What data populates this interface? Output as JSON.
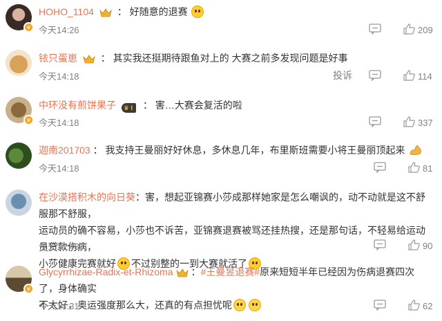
{
  "comments": [
    {
      "user": "HOHO_1104",
      "text": "好随意的退赛",
      "time": "今天14:26",
      "likes": "209"
    },
    {
      "user": "铱只蛋崽",
      "text": "其实我还挺期待跟鱼对上的 大赛之前多发现问题是好事",
      "time": "今天14:18",
      "likes": "114",
      "report_label": "投诉"
    },
    {
      "user": "中环没有煎饼果子",
      "rank": "I",
      "text": "害…大赛会复活的啦",
      "time": "今天14:18",
      "likes": "337"
    },
    {
      "user": "迦南201703",
      "text": "我支持王曼丽好好休息，多休息几年，布里斯班需要小将王曼丽顶起来",
      "time": "今天14:18",
      "likes": "81"
    },
    {
      "user": "在沙漠搭积木的向日葵",
      "text_line1": "害，想起亚锦赛小莎成那样她家是怎么嘲讽的，动不动就是这不舒服那不舒服，",
      "text_line2": "运动员的确不容易，小莎也不诉苦，亚锦赛退赛被骂还挂热搜，还是那句话，不轻易给运动员贷款伤病，",
      "text_line3a": "小莎健康完赛就好",
      "text_line3b": "不过别整的一到大赛就活了",
      "time": "今天14:46",
      "likes": "90"
    },
    {
      "user": "Glycyrrhizae-Radix-et-Rhizoma",
      "hashtag": "#王曼昱退赛#",
      "text_line1": "原来短短半年已经因为伤病退赛四次了，身体确实",
      "text_line2": "不太好，奥运强度那么大，还真的有点担忧呢",
      "time": "今天14:31",
      "likes": "62"
    }
  ],
  "colors": {
    "username": "#eb7350",
    "hashtag": "#eb7350",
    "meta": "#808080"
  },
  "icons": [
    "crown-icon",
    "vip-badge-icon",
    "reply-icon",
    "like-icon",
    "emoji-icon",
    "muscle-emoji-icon"
  ]
}
